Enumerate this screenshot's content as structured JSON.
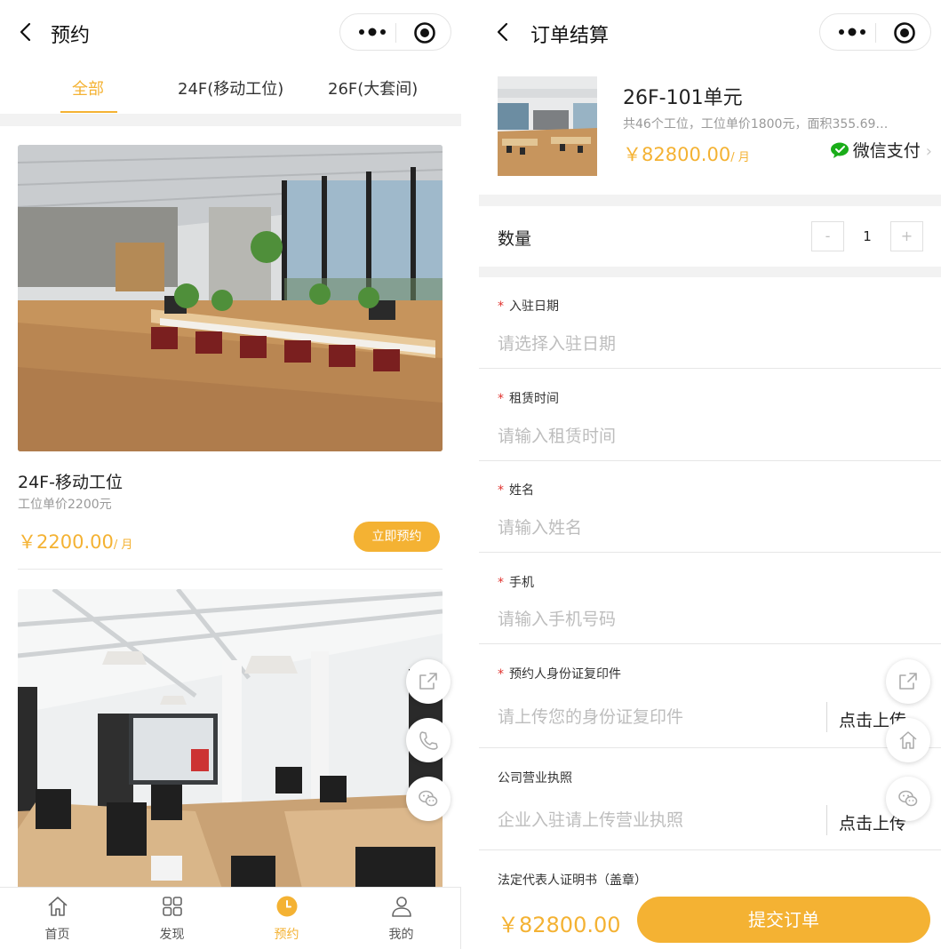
{
  "left": {
    "nav": {
      "title": "预约"
    },
    "tabs": [
      {
        "label": "全部",
        "active": true
      },
      {
        "label": "24F(移动工位)",
        "active": false
      },
      {
        "label": "26F(大套间)",
        "active": false
      }
    ],
    "listings": [
      {
        "title": "24F-移动工位",
        "subtitle": "工位单价2200元",
        "price": "￥2200.00",
        "unit": "/ 月",
        "button": "立即预约"
      }
    ],
    "tabbar": [
      {
        "label": "首页",
        "icon": "home-icon"
      },
      {
        "label": "发现",
        "icon": "grid-icon"
      },
      {
        "label": "预约",
        "icon": "clock-icon",
        "active": true
      },
      {
        "label": "我的",
        "icon": "user-icon"
      }
    ]
  },
  "right": {
    "nav": {
      "title": "订单结算"
    },
    "product": {
      "title": "26F-101单元",
      "desc": "共46个工位，工位单价1800元，面积355.69…",
      "price": "￥82800.00",
      "unit": "/ 月",
      "payment": "微信支付"
    },
    "quantity": {
      "label": "数量",
      "value": "1",
      "minus": "-",
      "plus": "+"
    },
    "form": [
      {
        "label": "入驻日期",
        "required": true,
        "placeholder": "请选择入驻日期"
      },
      {
        "label": "租赁时间",
        "required": true,
        "placeholder": "请输入租赁时间"
      },
      {
        "label": "姓名",
        "required": true,
        "placeholder": "请输入姓名"
      },
      {
        "label": "手机",
        "required": true,
        "placeholder": "请输入手机号码"
      },
      {
        "label": "预约人身份证复印件",
        "required": true,
        "placeholder": "请上传您的身份证复印件",
        "button": "点击上传"
      },
      {
        "label": "公司营业执照",
        "required": false,
        "placeholder": "企业入驻请上传营业执照",
        "button": "点击上传"
      },
      {
        "label": "法定代表人证明书（盖章）",
        "required": false
      }
    ],
    "required_mark": "*",
    "total": "￥82800.00",
    "submit": "提交订单"
  },
  "colors": {
    "accent": "#f4b233",
    "required": "#e0322e",
    "placeholder": "#bdbdbd"
  }
}
